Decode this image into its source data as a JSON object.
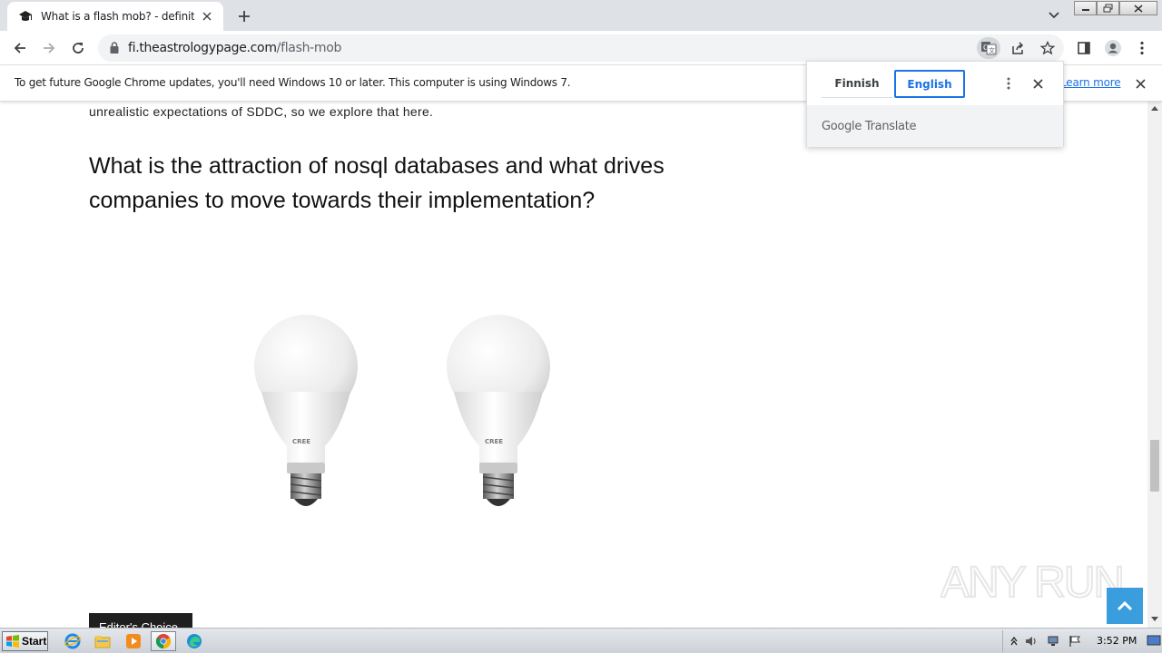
{
  "browser": {
    "tab": {
      "title": "What is a flash mob? - definition from",
      "close_label": "×"
    },
    "new_tab_label": "+",
    "omnibox": {
      "domain": "fi.theastrologypage.com",
      "path": "/flash-mob"
    }
  },
  "infobar": {
    "message": "To get future Google Chrome updates, you'll need Windows 10 or later. This computer is using Windows 7.",
    "learn_more": "Learn more"
  },
  "translate": {
    "source_language": "Finnish",
    "target_language": "English",
    "brand_google": "Google",
    "brand_translate": "Translate"
  },
  "page": {
    "partial_text": "unrealistic expectations of SDDC, so we explore that here.",
    "heading": "What is the attraction of nosql databases and what drives companies to move towards their implementation?",
    "bulb_label_1": "CREE",
    "bulb_label_2": "CREE",
    "editors_choice": "Editor's Choice",
    "watermark": "ANY RUN"
  },
  "taskbar": {
    "start_label": "Start",
    "clock": "3:52 PM"
  },
  "colors": {
    "accent": "#1a73e8",
    "back_to_top": "#3a9ede"
  }
}
